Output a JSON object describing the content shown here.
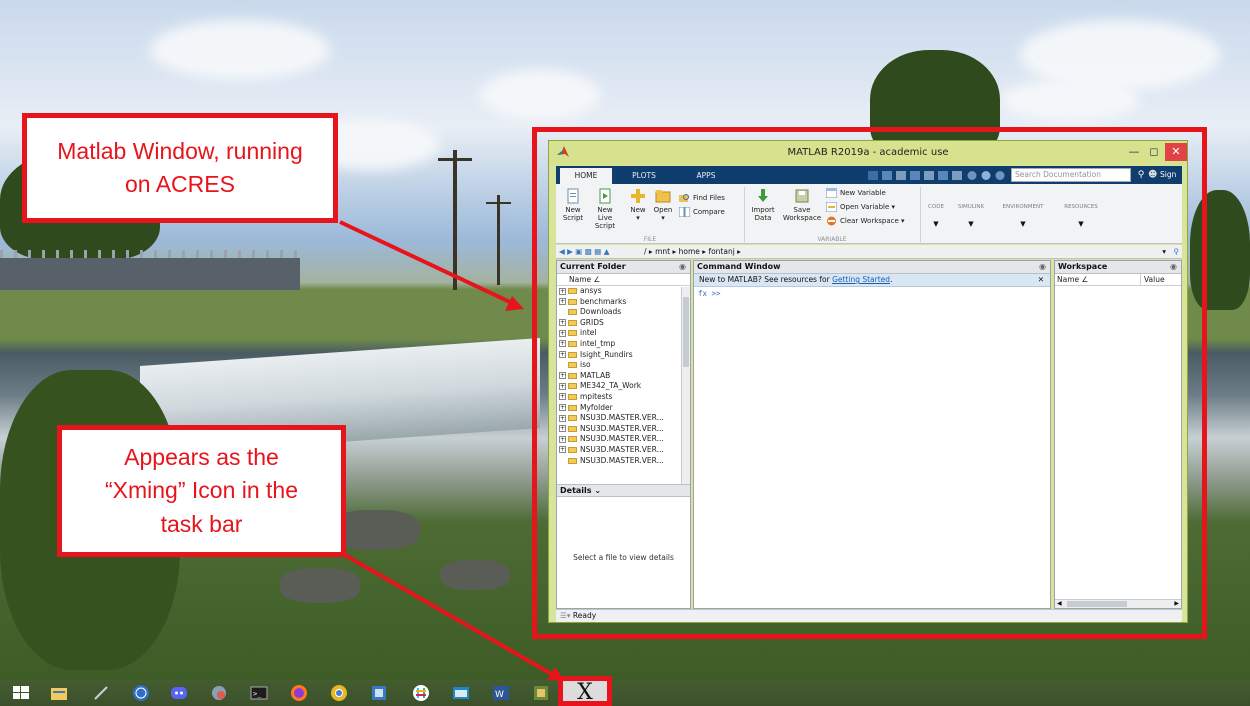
{
  "annotations": {
    "callout_top": "Matlab Window, running on ACRES",
    "callout_bottom": "Appears as the “Xming” Icon in the task bar"
  },
  "colors": {
    "annotation_red": "#e8141b",
    "window_frame": "#d8e39c",
    "ribbon_tab_bg": "#0f3e6e"
  },
  "matlab": {
    "title": "MATLAB R2019a - academic use",
    "tabs": [
      {
        "label": "HOME",
        "active": true
      },
      {
        "label": "PLOTS",
        "active": false
      },
      {
        "label": "APPS",
        "active": false
      }
    ],
    "search_placeholder": "Search Documentation",
    "sign_in": "Sign In",
    "ribbon": {
      "file": {
        "new_script": [
          "New",
          "Script"
        ],
        "new_live_script": [
          "New",
          "Live Script"
        ],
        "new": [
          "New",
          "▾"
        ],
        "open": [
          "Open",
          "▾"
        ],
        "find_files": "Find Files",
        "compare": "Compare",
        "label": "FILE"
      },
      "variable": {
        "import_data": [
          "Import",
          "Data"
        ],
        "save_workspace": [
          "Save",
          "Workspace"
        ],
        "new_variable": "New Variable",
        "open_variable": "Open Variable ▾",
        "clear_workspace": "Clear Workspace ▾",
        "label": "VARIABLE"
      },
      "collapsed_sections": [
        "CODE",
        "SIMULINK",
        "ENVIRONMENT",
        "RESOURCES"
      ]
    },
    "path": {
      "root": "/",
      "segments": [
        "mnt",
        "home",
        "fontanj"
      ]
    },
    "current_folder": {
      "title": "Current Folder",
      "column": "Name ∠",
      "items": [
        {
          "name": "ansys",
          "expandable": true
        },
        {
          "name": "benchmarks",
          "expandable": true
        },
        {
          "name": "Downloads",
          "expandable": false
        },
        {
          "name": "GRIDS",
          "expandable": true
        },
        {
          "name": "intel",
          "expandable": true
        },
        {
          "name": "intel_tmp",
          "expandable": true
        },
        {
          "name": "Isight_Rundirs",
          "expandable": true
        },
        {
          "name": "iso",
          "expandable": false
        },
        {
          "name": "MATLAB",
          "expandable": true
        },
        {
          "name": "ME342_TA_Work",
          "expandable": true
        },
        {
          "name": "mpitests",
          "expandable": true
        },
        {
          "name": "Myfolder",
          "expandable": true
        },
        {
          "name": "NSU3D.MASTER.VER...",
          "expandable": true
        },
        {
          "name": "NSU3D.MASTER.VER...",
          "expandable": true
        },
        {
          "name": "NSU3D.MASTER.VER...",
          "expandable": true
        },
        {
          "name": "NSU3D.MASTER.VER...",
          "expandable": true
        },
        {
          "name": "NSU3D.MASTER.VER...",
          "expandable": false
        }
      ],
      "details_title": "Details",
      "details_message": "Select a file to view details"
    },
    "command_window": {
      "title": "Command Window",
      "notice_text": "New to MATLAB? See resources for ",
      "notice_link": "Getting Started",
      "notice_suffix": ".",
      "prompt": "fx >>"
    },
    "workspace": {
      "title": "Workspace",
      "columns": [
        "Name ∠",
        "Value"
      ]
    },
    "status": "Ready"
  },
  "taskbar": {
    "icons": [
      "windows-start",
      "file-explorer",
      "tool",
      "clock-app",
      "discord",
      "app",
      "terminal",
      "firefox",
      "chrome",
      "app",
      "slack",
      "app",
      "word",
      "app",
      "xming"
    ],
    "xming_glyph": "X"
  }
}
